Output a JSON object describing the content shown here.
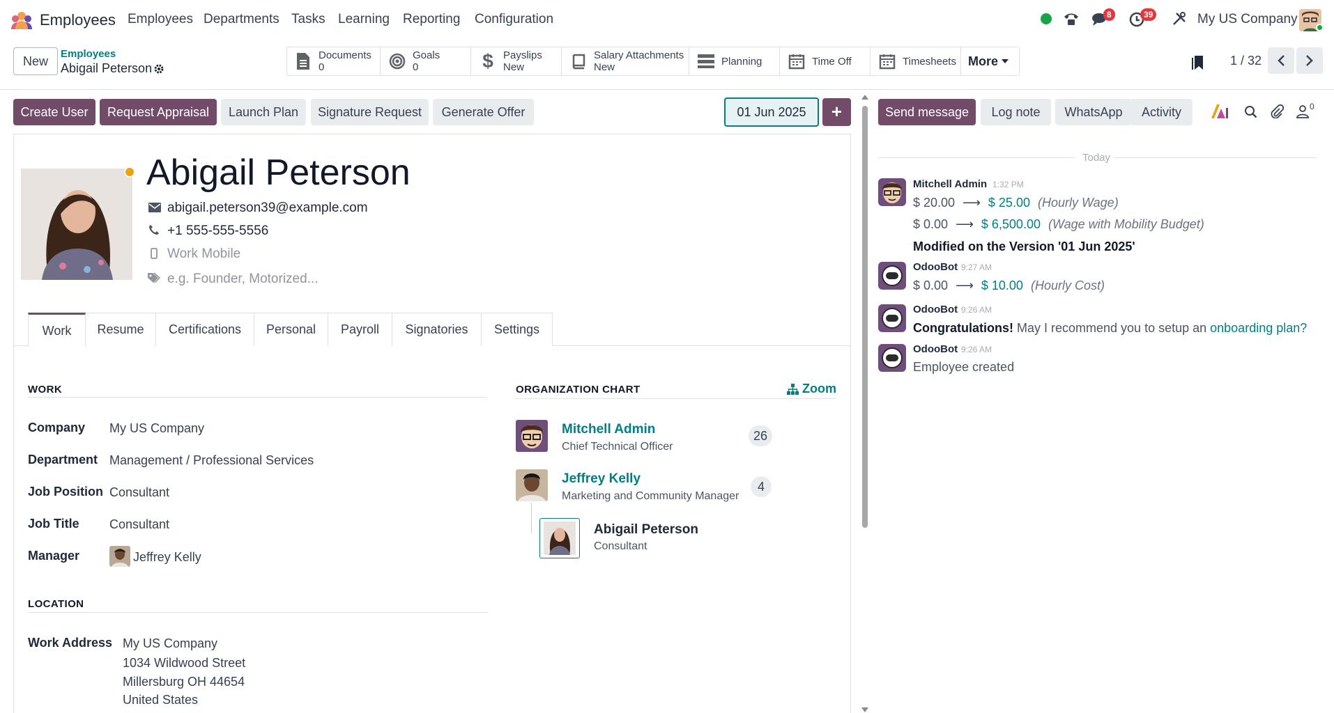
{
  "app": {
    "title": "Employees"
  },
  "nav": {
    "items": [
      "Employees",
      "Departments",
      "Tasks",
      "Learning",
      "Reporting",
      "Configuration"
    ]
  },
  "systray": {
    "messages_badge": "8",
    "activity_badge": "39",
    "company": "My US Company"
  },
  "control": {
    "new_label": "New",
    "breadcrumb_parent": "Employees",
    "breadcrumb_current": "Abigail Peterson",
    "smart_buttons": [
      {
        "label": "Documents",
        "value": "0",
        "icon": "document-icon"
      },
      {
        "label": "Goals",
        "value": "0",
        "icon": "target-icon"
      },
      {
        "label": "Payslips",
        "value": "New",
        "icon": "dollar-icon"
      },
      {
        "label": "Salary Attachments",
        "value": "New",
        "icon": "book-icon"
      },
      {
        "label": "Planning",
        "icon": "planning-icon"
      },
      {
        "label": "Time Off",
        "icon": "calendar-icon"
      },
      {
        "label": "Timesheets",
        "icon": "calendar-icon"
      }
    ],
    "more_label": "More",
    "pager": "1 / 32"
  },
  "actions": {
    "create_user": "Create User",
    "request_appraisal": "Request Appraisal",
    "launch_plan": "Launch Plan",
    "signature_request": "Signature Request",
    "generate_offer": "Generate Offer",
    "version_date": "01 Jun 2025"
  },
  "employee": {
    "name": "Abigail Peterson",
    "email": "abigail.peterson39@example.com",
    "phone": "+1 555-555-5556",
    "mobile_placeholder": "Work Mobile",
    "tags_placeholder": "e.g. Founder, Motorized..."
  },
  "tabs": [
    "Work",
    "Resume",
    "Certifications",
    "Personal",
    "Payroll",
    "Signatories",
    "Settings"
  ],
  "work": {
    "section_title": "WORK",
    "fields": [
      {
        "label": "Company",
        "value": "My US Company"
      },
      {
        "label": "Department",
        "value": "Management / Professional Services"
      },
      {
        "label": "Job Position",
        "value": "Consultant"
      },
      {
        "label": "Job Title",
        "value": "Consultant"
      },
      {
        "label": "Manager",
        "value": "Jeffrey Kelly"
      }
    ]
  },
  "location": {
    "section_title": "LOCATION",
    "label": "Work Address",
    "lines": [
      "My US Company",
      "1034 Wildwood Street",
      "Millersburg OH 44654",
      "United States"
    ]
  },
  "org_chart": {
    "title": "ORGANIZATION CHART",
    "zoom_label": "Zoom",
    "people": [
      {
        "name": "Mitchell Admin",
        "role": "Chief Technical Officer",
        "count": "26"
      },
      {
        "name": "Jeffrey Kelly",
        "role": "Marketing and Community Manager",
        "count": "4"
      },
      {
        "name": "Abigail Peterson",
        "role": "Consultant"
      }
    ]
  },
  "chatter": {
    "send_message": "Send message",
    "log_note": "Log note",
    "whatsapp": "WhatsApp",
    "activity": "Activity",
    "followers_count": "0",
    "today": "Today",
    "msg1": {
      "author": "Mitchell Admin",
      "time": "1:32 PM",
      "changes": [
        {
          "old": "$ 20.00",
          "new": "$ 25.00",
          "field": "(Hourly Wage)"
        },
        {
          "old": "$ 0.00",
          "new": "$ 6,500.00",
          "field": "(Wage with Mobility Budget)"
        }
      ],
      "note": "Modified on the Version '01 Jun 2025'"
    },
    "msg2": {
      "author": "OdooBot",
      "time": "9:27 AM",
      "old": "$ 0.00",
      "new": "$ 10.00",
      "field": "(Hourly Cost)"
    },
    "msg3": {
      "author": "OdooBot",
      "time": "9:26 AM",
      "bold": "Congratulations!",
      "text": " May I recommend you to setup an ",
      "link": "onboarding plan?"
    },
    "msg4": {
      "author": "OdooBot",
      "time": "9:26 AM",
      "text": "Employee created"
    }
  }
}
